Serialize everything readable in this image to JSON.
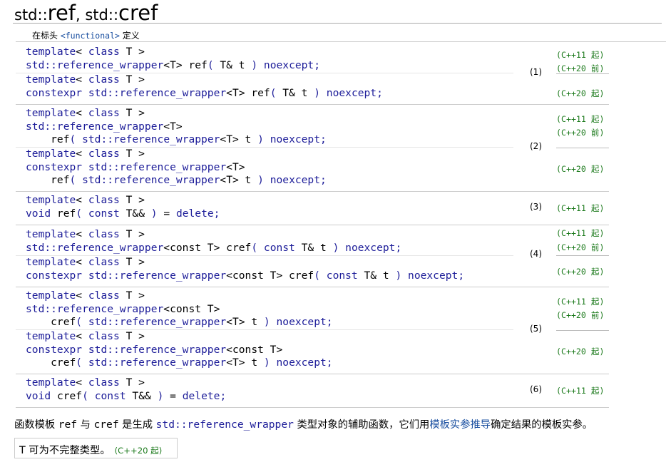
{
  "title": {
    "prefix1": "std::",
    "name1": "ref",
    "comma": ", ",
    "prefix2": "std::",
    "name2": "cref"
  },
  "header": {
    "before": "在标头 ",
    "link": "<functional>",
    "after": " 定义"
  },
  "declarations": [
    {
      "number": "(1)",
      "blocks": [
        [
          "template< class T >",
          "std::reference_wrapper<T> ref( T& t ) noexcept;"
        ],
        [
          "template< class T >",
          "constexpr std::reference_wrapper<T> ref( T& t ) noexcept;"
        ]
      ],
      "versions": [
        "(C++11 起)",
        "(C++20 前)",
        "(C++20 起)"
      ]
    },
    {
      "number": "(2)",
      "blocks": [
        [
          "template< class T >",
          "std::reference_wrapper<T>",
          "    ref( std::reference_wrapper<T> t ) noexcept;"
        ],
        [
          "template< class T >",
          "constexpr std::reference_wrapper<T>",
          "    ref( std::reference_wrapper<T> t ) noexcept;"
        ]
      ],
      "versions": [
        "(C++11 起)",
        "(C++20 前)",
        "(C++20 起)"
      ]
    },
    {
      "number": "(3)",
      "blocks": [
        [
          "template< class T >",
          "void ref( const T&& ) = delete;"
        ]
      ],
      "versions": [
        "(C++11 起)"
      ]
    },
    {
      "number": "(4)",
      "blocks": [
        [
          "template< class T >",
          "std::reference_wrapper<const T> cref( const T& t ) noexcept;"
        ],
        [
          "template< class T >",
          "constexpr std::reference_wrapper<const T> cref( const T& t ) noexcept;"
        ]
      ],
      "versions": [
        "(C++11 起)",
        "(C++20 前)",
        "(C++20 起)"
      ]
    },
    {
      "number": "(5)",
      "blocks": [
        [
          "template< class T >",
          "std::reference_wrapper<const T>",
          "    cref( std::reference_wrapper<T> t ) noexcept;"
        ],
        [
          "template< class T >",
          "constexpr std::reference_wrapper<const T>",
          "    cref( std::reference_wrapper<T> t ) noexcept;"
        ]
      ],
      "versions": [
        "(C++11 起)",
        "(C++20 前)",
        "(C++20 起)"
      ]
    },
    {
      "number": "(6)",
      "blocks": [
        [
          "template< class T >",
          "void cref( const T&& ) = delete;"
        ]
      ],
      "versions": [
        "(C++11 起)"
      ]
    }
  ],
  "description": {
    "p1": "函数模板 ",
    "c1": "ref",
    "p2": " 与 ",
    "c2": "cref",
    "p3": " 是生成 ",
    "c3": "std::reference_wrapper",
    "p4": " 类型对象的辅助函数，它们用",
    "link": "模板实参推导",
    "p5": "确定结果的模板实参。"
  },
  "note": {
    "text": "T 可为不完整类型。",
    "version": "(C++20 起)"
  }
}
